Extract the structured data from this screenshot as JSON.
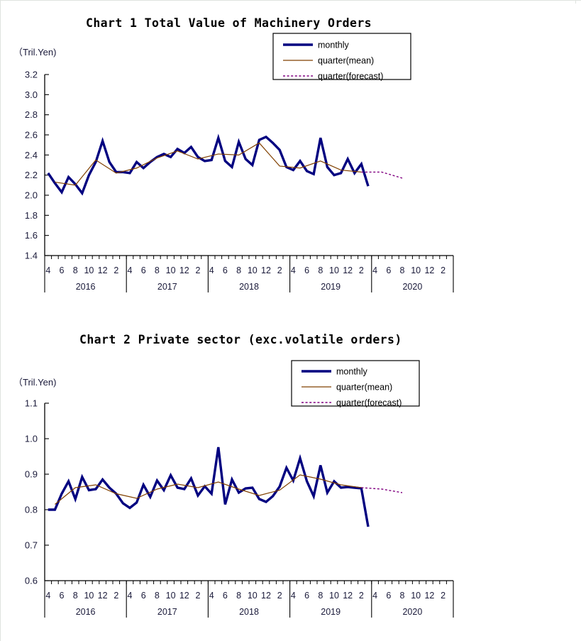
{
  "colors": {
    "monthly": "#000080",
    "quarter_mean": "#804000",
    "quarter_forecast": "#800080",
    "axis": "#000000",
    "text": "#1a1a3a"
  },
  "legend": {
    "monthly_label": "monthly",
    "mean_label": "quarter(mean)",
    "forecast_label": "quarter(forecast)"
  },
  "chart1": {
    "title": "Chart 1 Total Value of Machinery Orders",
    "unit": "（Tril.Yen)"
  },
  "chart2": {
    "title": "Chart 2 Private sector (exc.volatile orders)",
    "unit": "（Tril.Yen)"
  },
  "chart_data": [
    {
      "type": "line",
      "title": "Chart 1 Total Value of Machinery Orders",
      "xlabel": "",
      "ylabel": "（Tril.Yen)",
      "ylim": [
        1.4,
        3.2
      ],
      "yticks": [
        "1.4",
        "1.6",
        "1.8",
        "2.0",
        "2.2",
        "2.4",
        "2.6",
        "2.8",
        "3.0",
        "3.2"
      ],
      "grid": false,
      "legend_position": "top-right",
      "x_month_labels": [
        "4",
        "6",
        "8",
        "10",
        "12",
        "2"
      ],
      "x_year_groups": [
        "2016",
        "2017",
        "2018",
        "2019",
        "2020"
      ],
      "x_months_per_group": 12,
      "series": [
        {
          "name": "monthly",
          "values": [
            2.22,
            2.12,
            2.03,
            2.18,
            2.11,
            2.02,
            2.2,
            2.33,
            2.54,
            2.33,
            2.23,
            2.23,
            2.22,
            2.33,
            2.27,
            2.33,
            2.38,
            2.41,
            2.38,
            2.46,
            2.42,
            2.48,
            2.38,
            2.34,
            2.35,
            2.57,
            2.34,
            2.28,
            2.53,
            2.36,
            2.3,
            2.55,
            2.58,
            2.52,
            2.45,
            2.28,
            2.25,
            2.34,
            2.24,
            2.21,
            2.57,
            2.28,
            2.2,
            2.22,
            2.36,
            2.22,
            2.31,
            2.09
          ]
        },
        {
          "name": "quarter(mean)",
          "values": [
            2.13,
            2.1,
            2.35,
            2.22,
            2.27,
            2.37,
            2.44,
            2.36,
            2.41,
            2.4,
            2.52,
            2.29,
            2.27,
            2.34,
            2.25,
            2.23
          ]
        },
        {
          "name": "quarter(forecast)",
          "values": [
            2.23,
            2.17
          ]
        }
      ]
    },
    {
      "type": "line",
      "title": "Chart 2 Private sector (exc.volatile orders)",
      "xlabel": "",
      "ylabel": "（Tril.Yen)",
      "ylim": [
        0.6,
        1.1
      ],
      "yticks": [
        "0.6",
        "0.7",
        "0.8",
        "0.9",
        "1.0",
        "1.1"
      ],
      "grid": false,
      "legend_position": "top-right",
      "x_month_labels": [
        "4",
        "6",
        "8",
        "10",
        "12",
        "2"
      ],
      "x_year_groups": [
        "2016",
        "2017",
        "2018",
        "2019",
        "2020"
      ],
      "x_months_per_group": 12,
      "series": [
        {
          "name": "monthly",
          "values": [
            0.8,
            0.8,
            0.845,
            0.88,
            0.83,
            0.892,
            0.855,
            0.858,
            0.885,
            0.862,
            0.845,
            0.818,
            0.805,
            0.82,
            0.87,
            0.836,
            0.882,
            0.855,
            0.897,
            0.862,
            0.858,
            0.888,
            0.84,
            0.866,
            0.845,
            0.976,
            0.815,
            0.885,
            0.848,
            0.86,
            0.862,
            0.83,
            0.822,
            0.838,
            0.865,
            0.918,
            0.882,
            0.945,
            0.88,
            0.838,
            0.925,
            0.848,
            0.88,
            0.862,
            0.864,
            0.862,
            0.86,
            0.752
          ]
        },
        {
          "name": "quarter(mean)",
          "values": [
            0.815,
            0.862,
            0.87,
            0.845,
            0.832,
            0.858,
            0.872,
            0.862,
            0.878,
            0.858,
            0.84,
            0.855,
            0.898,
            0.886,
            0.87,
            0.862
          ]
        },
        {
          "name": "quarter(forecast)",
          "values": [
            0.858,
            0.848
          ]
        }
      ]
    }
  ]
}
